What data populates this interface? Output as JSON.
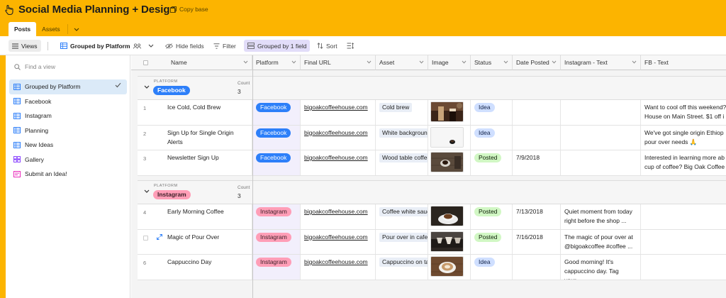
{
  "app": {
    "title": "Social Media Planning + Design",
    "copy_base": "Copy base",
    "tabs": [
      "Posts",
      "Assets"
    ]
  },
  "toolbar": {
    "views": "Views",
    "current_view": "Grouped by Platform",
    "hide_fields": "Hide fields",
    "filter": "Filter",
    "grouped": "Grouped by 1 field",
    "sort": "Sort"
  },
  "sidebar": {
    "search_placeholder": "Find a view",
    "items": [
      {
        "label": "Grouped by Platform",
        "icon": "grid-icon",
        "active": true
      },
      {
        "label": "Facebook",
        "icon": "grid-icon"
      },
      {
        "label": "Instagram",
        "icon": "grid-icon"
      },
      {
        "label": "Planning",
        "icon": "grid-icon"
      },
      {
        "label": "New Ideas",
        "icon": "grid-icon"
      },
      {
        "label": "Gallery",
        "icon": "gallery-icon"
      },
      {
        "label": "Submit an Idea!",
        "icon": "form-icon"
      }
    ]
  },
  "columns": [
    "Name",
    "Platform",
    "Final URL",
    "Asset",
    "Image",
    "Status",
    "Date Posted",
    "Instagram - Text",
    "FB - Text"
  ],
  "groups": [
    {
      "label": "PLATFORM",
      "value": "Facebook",
      "count_label": "Count",
      "count": "3",
      "rows": [
        {
          "idx": "1",
          "name": "Ice Cold, Cold Brew",
          "platform": "Facebook",
          "url": "bigoakcoffeehouse.com",
          "asset": "Cold brew",
          "status": "Idea",
          "date": "",
          "ig_text": "",
          "fb_text": "Want to cool off this weekend? House on Main Street. $1 off i"
        },
        {
          "idx": "2",
          "name": "Sign Up for Single Origin Alerts",
          "platform": "Facebook",
          "url": "bigoakcoffeehouse.com",
          "asset": "White background",
          "status": "Idea",
          "date": "",
          "ig_text": "",
          "fb_text": "We've got single origin Ethiop pour over needs 🙏"
        },
        {
          "idx": "3",
          "name": "Newsletter Sign Up",
          "platform": "Facebook",
          "url": "bigoakcoffeehouse.com",
          "asset": "Wood table coffee",
          "status": "Posted",
          "date": "7/9/2018",
          "ig_text": "",
          "fb_text": "Interested in learning more ab cup of coffee? Big Oak Coffee"
        }
      ]
    },
    {
      "label": "PLATFORM",
      "value": "Instagram",
      "count_label": "Count",
      "count": "3",
      "rows": [
        {
          "idx": "4",
          "name": "Early Morning Coffee",
          "platform": "Instagram",
          "url": "bigoakcoffeehouse.com",
          "asset": "Coffee white saucer",
          "status": "Posted",
          "date": "7/13/2018",
          "ig_text": "Quiet moment from today right before the shop ...",
          "fb_text": ""
        },
        {
          "idx": "",
          "name": "Magic of Pour Over",
          "platform": "Instagram",
          "url": "bigoakcoffeehouse.com",
          "asset": "Pour over in cafe",
          "status": "Posted",
          "date": "7/16/2018",
          "ig_text": "The magic of pour over at @bigoakcoffee #coffee ...",
          "fb_text": ""
        },
        {
          "idx": "6",
          "name": "Cappuccino Day",
          "platform": "Instagram",
          "url": "bigoakcoffeehouse.com",
          "asset": "Cappuccino on table",
          "status": "Idea",
          "date": "",
          "ig_text": "Good morning! It's cappuccino day. Tag your...",
          "fb_text": ""
        }
      ]
    }
  ],
  "colors": {
    "brand": "#fcb400",
    "facebook_pill": "#2d7ff9",
    "instagram_pill": "#ff9eb7",
    "idea_pill": "#cfdfff",
    "posted_pill": "#d1f7c4"
  }
}
